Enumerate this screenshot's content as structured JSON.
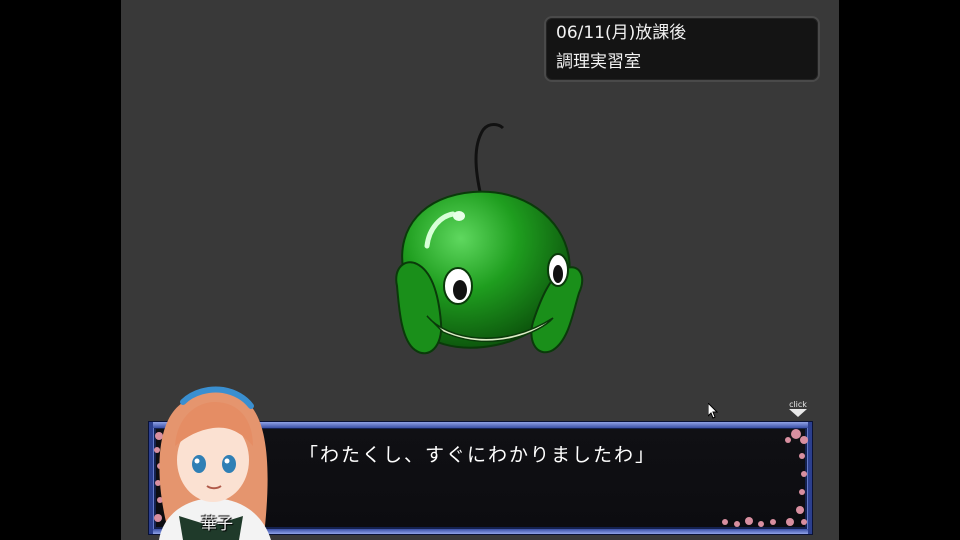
{
  "info": {
    "date": "06/11(月)放課後",
    "location": "調理実習室"
  },
  "dialogue": {
    "speaker": "華子",
    "text": "「わたくし、すぐにわかりましたわ」"
  },
  "ui": {
    "click_label": "click"
  },
  "colors": {
    "stage_bg": "#393939",
    "window_frame": "#2c3f8e",
    "creature_green": "#1e9a1e"
  },
  "icons": [
    "cursor-arrow-icon",
    "click-advance-arrow-icon"
  ]
}
